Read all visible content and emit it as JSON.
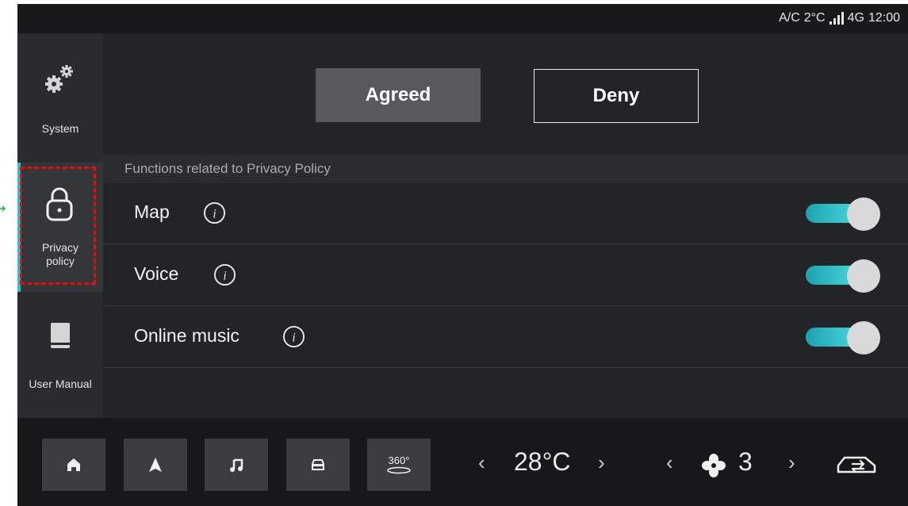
{
  "status": {
    "ac": "A/C",
    "temp": "2°C",
    "network": "4G",
    "time": "12:00"
  },
  "sidebar": {
    "items": [
      {
        "label": "System",
        "icon": "gear-icon"
      },
      {
        "label": "Privacy policy",
        "label_line1": "Privacy",
        "label_line2": "policy",
        "icon": "lock-icon",
        "active": true
      },
      {
        "label": "User Manual",
        "icon": "book-icon"
      }
    ]
  },
  "consent": {
    "agree_label": "Agreed",
    "deny_label": "Deny"
  },
  "section_title": "Functions related to Privacy Policy",
  "functions": [
    {
      "name": "Map",
      "enabled": true
    },
    {
      "name": "Voice",
      "enabled": true
    },
    {
      "name": "Online music",
      "enabled": true
    }
  ],
  "dock": {
    "buttons": [
      "home-icon",
      "navigation-icon",
      "music-icon",
      "car-icon",
      "360-view-icon"
    ],
    "view_label": "360°",
    "temperature": "28°C",
    "fan_level": "3"
  },
  "colors": {
    "accent": "#27c3cf",
    "toggle_on": "#3ccfd9",
    "highlight": "#e01010",
    "background": "#1f2023"
  }
}
